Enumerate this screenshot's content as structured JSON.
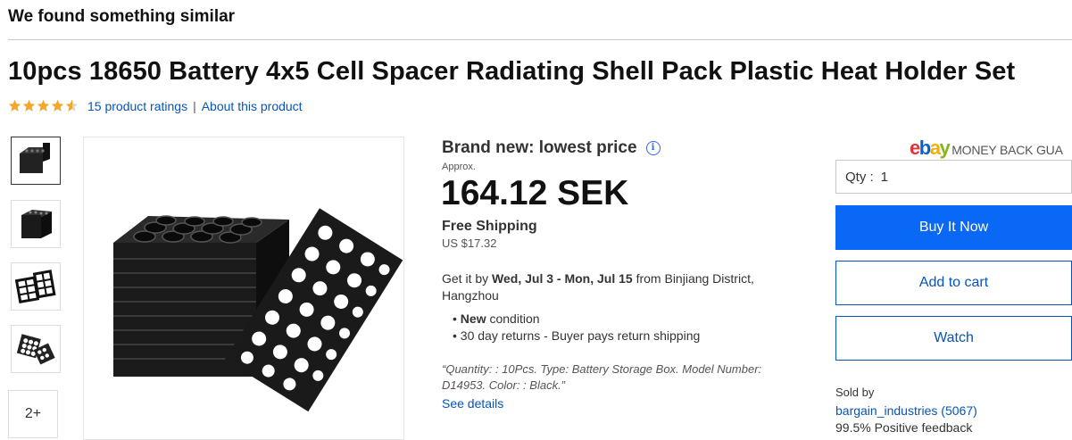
{
  "header": {
    "similar_title": "We found something similar"
  },
  "product": {
    "title": "10pcs 18650 Battery 4x5 Cell Spacer Radiating Shell Pack Plastic Heat Holder Set",
    "rating": 4.5,
    "ratings_link": "15 product ratings",
    "about_link": "About this product"
  },
  "gallery": {
    "thumbnails": [
      "thumbnail-1",
      "thumbnail-2",
      "thumbnail-3",
      "thumbnail-4"
    ],
    "more_label": "2+"
  },
  "pricing": {
    "label": "Brand new: lowest price",
    "approx": "Approx.",
    "price": "164.12 SEK",
    "shipping": "Free Shipping",
    "shipping_usd": "US $17.32",
    "delivery_prefix": "Get it by ",
    "delivery_dates": "Wed, Jul 3 - Mon, Jul 15",
    "delivery_suffix": " from Binjiang District, Hangzhou",
    "condition_bold": "New",
    "condition_rest": " condition",
    "returns": "30 day returns - Buyer pays return shipping",
    "specifics": "“Quantity: : 10Pcs. Type: Battery Storage Box. Model Number: D14953. Color: : Black.”",
    "see_details": "See details"
  },
  "buybox": {
    "mbg_text": "MONEY BACK GUA",
    "qty_label": "Qty :",
    "qty_value": "1",
    "buy_now": "Buy It Now",
    "add_to_cart": "Add to cart",
    "watch": "Watch",
    "sold_by": "Sold by",
    "seller_name": "bargain_industries",
    "seller_count": "(5067)",
    "feedback": "99.5% Positive feedback"
  },
  "colors": {
    "link": "#0654ba",
    "buy_button": "#0968f6",
    "star": "#f5a623"
  }
}
